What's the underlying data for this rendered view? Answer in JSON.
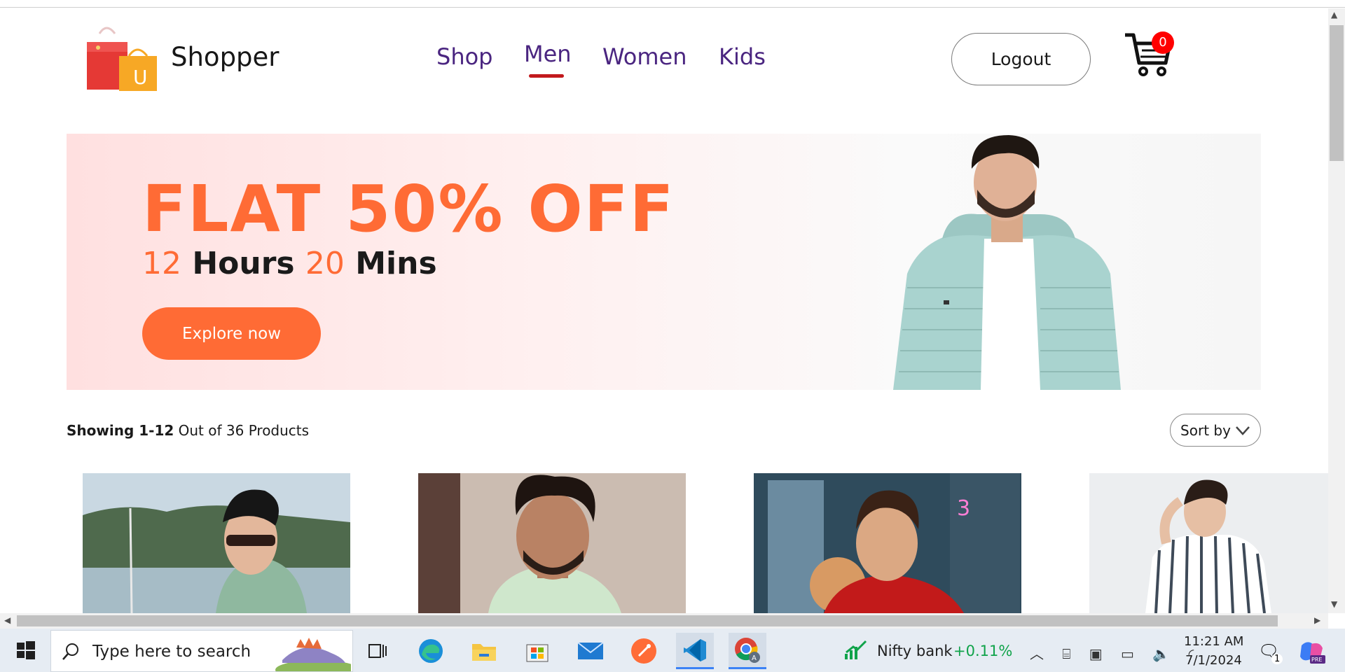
{
  "brand": {
    "name": "Shopper"
  },
  "nav": {
    "items": [
      {
        "label": "Shop",
        "active": false
      },
      {
        "label": "Men",
        "active": true
      },
      {
        "label": "Women",
        "active": false
      },
      {
        "label": "Kids",
        "active": false
      }
    ],
    "active_color": "#c2191c",
    "link_color": "#4a2580"
  },
  "header": {
    "logout_label": "Logout",
    "cart_count": "0"
  },
  "banner": {
    "title": "FLAT 50% OFF",
    "hours": "12",
    "hours_label": "Hours",
    "mins": "20",
    "mins_label": "Mins",
    "cta_label": "Explore now",
    "accent": "#ff6b35"
  },
  "listing": {
    "showing_range": "Showing 1-12",
    "showing_rest": "Out of 36 Products",
    "sort_label": "Sort by"
  },
  "taskbar": {
    "search_placeholder": "Type here to search",
    "nifty_label": "Nifty bank",
    "nifty_change": "+0.11%",
    "time": "11:21 AM",
    "date": "7/1/2024",
    "notification_count": "1"
  }
}
